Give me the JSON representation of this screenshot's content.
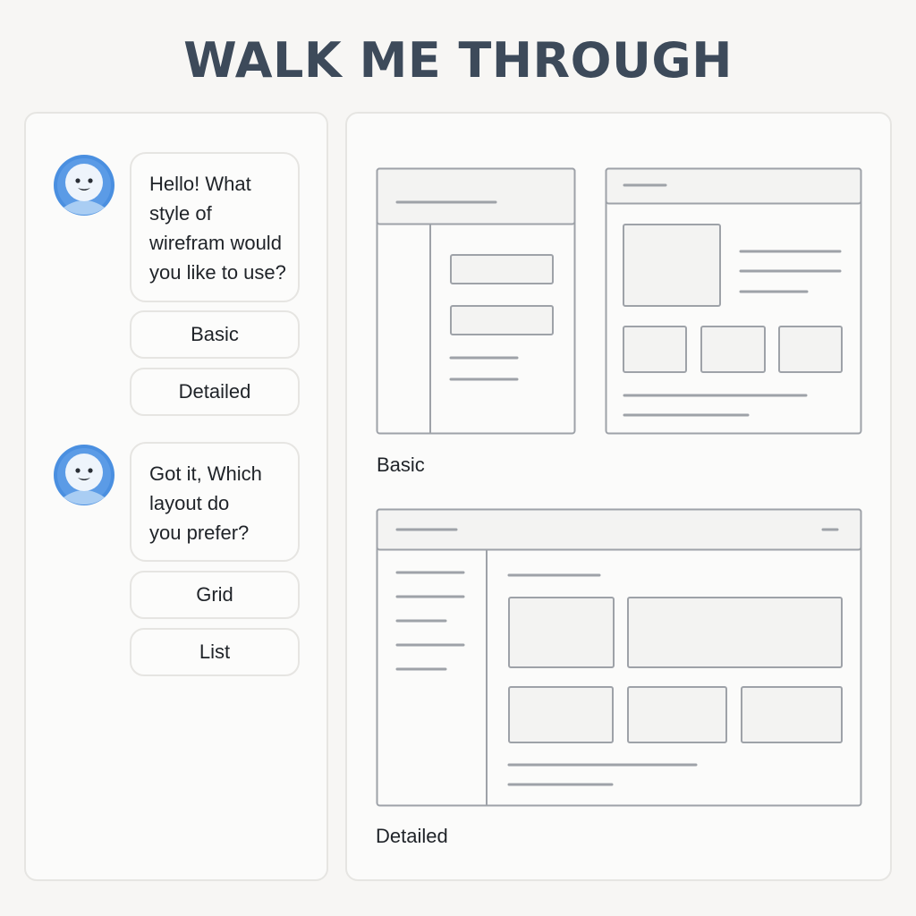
{
  "page": {
    "title": "WALK ME THROUGH"
  },
  "chat": {
    "messages": [
      {
        "lines": [
          "Hello! What",
          "style of",
          "wirefram would",
          "you like to use?"
        ]
      },
      {
        "lines": [
          "Got it, Which",
          "layout do",
          "you prefer?"
        ]
      }
    ],
    "options_style": [
      "Basic",
      "Detailed"
    ],
    "options_layout": [
      "Grid",
      "List"
    ],
    "avatar_icon": "smiley-face-icon",
    "avatar_color": "#4a8fe0"
  },
  "preview": {
    "basic_label": "Basic",
    "detailed_label": "Detailed"
  },
  "colors": {
    "background": "#f7f6f4",
    "panel_border": "#e6e5e2",
    "wire_stroke": "#9ea2a8",
    "wire_fill": "#f3f3f2",
    "title": "#3d4a5a"
  }
}
